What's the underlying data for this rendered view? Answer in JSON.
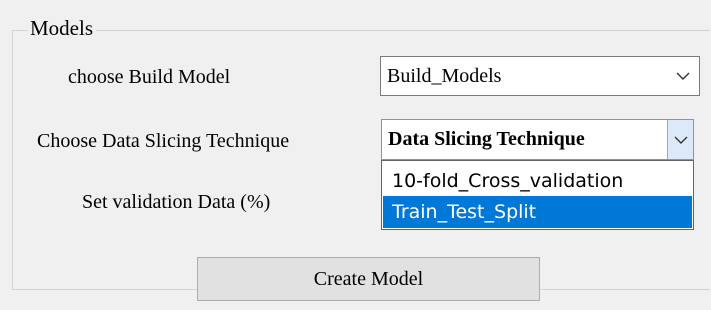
{
  "group": {
    "title": "Models"
  },
  "build_model": {
    "label": "choose Build Model",
    "selected": "Build_Models"
  },
  "data_slicing": {
    "label": "Choose Data Slicing Technique",
    "selected": "Data Slicing Technique",
    "options": [
      "10-fold_Cross_validation",
      "Train_Test_Split"
    ],
    "highlighted_option": "Train_Test_Split"
  },
  "validation": {
    "label": "Set validation Data (%)"
  },
  "create_button": {
    "label": "Create Model"
  },
  "colors": {
    "window_bg": "#f0f0f0",
    "highlight": "#0078d7",
    "combo_focus_border": "#6b9bd6",
    "arrow_button_bg": "#dbe9f8"
  },
  "icons": {
    "combo_arrow": "chevron-down-icon"
  }
}
